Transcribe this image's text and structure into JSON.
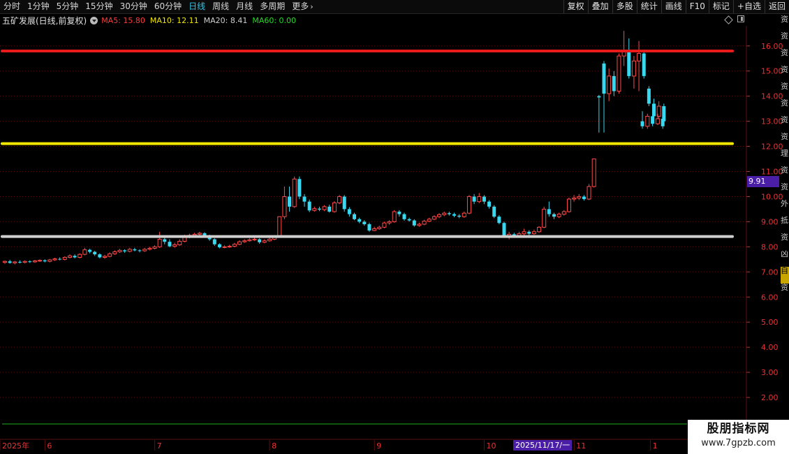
{
  "toolbar": {
    "periods": [
      "分时",
      "1分钟",
      "5分钟",
      "15分钟",
      "30分钟",
      "60分钟",
      "日线",
      "周线",
      "月线",
      "多周期",
      "更多"
    ],
    "active_period": "日线",
    "tools": [
      "复权",
      "叠加",
      "多股",
      "统计",
      "画线",
      "F10",
      "标记",
      "+自选",
      "返回"
    ]
  },
  "legend": {
    "title": "五矿发展(日线,前复权)",
    "ma": [
      {
        "label": "MA5: 15.80",
        "color": "#ff3b3b"
      },
      {
        "label": "MA10: 12.11",
        "color": "#f2e600"
      },
      {
        "label": "MA20: 8.41",
        "color": "#d0d0d0"
      },
      {
        "label": "MA60: 0.00",
        "color": "#22dd22"
      }
    ]
  },
  "price_tag": "9.91",
  "date_tag": "2025/11/17/一",
  "sidebar_items": [
    "资",
    "资",
    "资",
    "资",
    "资",
    "资",
    "资",
    "资",
    "理",
    "资",
    "资",
    "外",
    "抵",
    "资",
    "凶",
    "自",
    "资"
  ],
  "watermark": {
    "line1": "股朋指标网",
    "line2": "www.7gpzb.com"
  },
  "colors": {
    "up": "#ff4a4a",
    "down": "#37d8f0",
    "grid": "#5a1010",
    "background": "#000000"
  },
  "chart_data": {
    "type": "candlestick",
    "ylim": [
      1.0,
      16.8
    ],
    "y_ticks": [
      2.0,
      3.0,
      4.0,
      5.0,
      6.0,
      7.0,
      8.0,
      9.0,
      10.0,
      11.0,
      12.0,
      13.0,
      14.0,
      15.0,
      16.0
    ],
    "horizontal_lines": [
      {
        "value": 15.8,
        "color": "#e81a1a"
      },
      {
        "value": 12.11,
        "color": "#f2e600"
      },
      {
        "value": 8.41,
        "color": "#cfcfcf"
      }
    ],
    "x_labels": [
      {
        "text": "2025年",
        "index": 0
      },
      {
        "text": "6",
        "index": 9
      },
      {
        "text": "7",
        "index": 31
      },
      {
        "text": "8",
        "index": 54
      },
      {
        "text": "9",
        "index": 75
      },
      {
        "text": "10",
        "index": 97
      },
      {
        "text": "11",
        "index": 115
      },
      {
        "text": "1",
        "index": 155
      }
    ],
    "candles": [
      [
        7.38,
        7.42,
        7.32,
        7.45
      ],
      [
        7.42,
        7.36,
        7.33,
        7.48
      ],
      [
        7.36,
        7.4,
        7.3,
        7.44
      ],
      [
        7.4,
        7.38,
        7.34,
        7.46
      ],
      [
        7.38,
        7.42,
        7.34,
        7.46
      ],
      [
        7.42,
        7.4,
        7.36,
        7.46
      ],
      [
        7.4,
        7.44,
        7.36,
        7.48
      ],
      [
        7.44,
        7.46,
        7.4,
        7.5
      ],
      [
        7.46,
        7.42,
        7.38,
        7.5
      ],
      [
        7.42,
        7.48,
        7.38,
        7.52
      ],
      [
        7.48,
        7.52,
        7.44,
        7.56
      ],
      [
        7.52,
        7.5,
        7.46,
        7.58
      ],
      [
        7.5,
        7.58,
        7.46,
        7.62
      ],
      [
        7.58,
        7.64,
        7.54,
        7.7
      ],
      [
        7.64,
        7.58,
        7.54,
        7.7
      ],
      [
        7.58,
        7.7,
        7.54,
        7.74
      ],
      [
        7.7,
        7.88,
        7.66,
        7.96
      ],
      [
        7.88,
        7.8,
        7.74,
        7.92
      ],
      [
        7.8,
        7.7,
        7.64,
        7.84
      ],
      [
        7.7,
        7.58,
        7.54,
        7.74
      ],
      [
        7.58,
        7.62,
        7.52,
        7.68
      ],
      [
        7.62,
        7.72,
        7.58,
        7.78
      ],
      [
        7.72,
        7.8,
        7.68,
        7.86
      ],
      [
        7.8,
        7.86,
        7.76,
        7.92
      ],
      [
        7.86,
        7.82,
        7.76,
        7.9
      ],
      [
        7.82,
        7.9,
        7.78,
        7.96
      ],
      [
        7.9,
        7.86,
        7.82,
        7.96
      ],
      [
        7.86,
        7.84,
        7.78,
        7.9
      ],
      [
        7.84,
        7.9,
        7.8,
        7.96
      ],
      [
        7.9,
        7.94,
        7.86,
        8.0
      ],
      [
        7.94,
        8.0,
        7.9,
        8.06
      ],
      [
        8.0,
        8.3,
        7.96,
        8.6
      ],
      [
        8.3,
        8.2,
        8.1,
        8.4
      ],
      [
        8.2,
        8.02,
        7.98,
        8.3
      ],
      [
        8.02,
        8.08,
        7.96,
        8.16
      ],
      [
        8.08,
        8.22,
        8.04,
        8.3
      ],
      [
        8.22,
        8.4,
        8.18,
        8.48
      ],
      [
        8.4,
        8.46,
        8.34,
        8.52
      ],
      [
        8.46,
        8.5,
        8.4,
        8.56
      ],
      [
        8.5,
        8.54,
        8.44,
        8.6
      ],
      [
        8.54,
        8.42,
        8.36,
        8.58
      ],
      [
        8.42,
        8.3,
        8.24,
        8.48
      ],
      [
        8.3,
        8.1,
        8.04,
        8.34
      ],
      [
        8.1,
        7.98,
        7.94,
        8.14
      ],
      [
        7.98,
        8.0,
        7.94,
        8.06
      ],
      [
        8.0,
        8.02,
        7.96,
        8.08
      ],
      [
        8.02,
        8.1,
        7.98,
        8.16
      ],
      [
        8.1,
        8.2,
        8.06,
        8.26
      ],
      [
        8.2,
        8.24,
        8.16,
        8.3
      ],
      [
        8.24,
        8.28,
        8.2,
        8.34
      ],
      [
        8.28,
        8.3,
        8.24,
        8.36
      ],
      [
        8.3,
        8.18,
        8.12,
        8.34
      ],
      [
        8.18,
        8.24,
        8.14,
        8.3
      ],
      [
        8.24,
        8.3,
        8.2,
        8.38
      ],
      [
        8.3,
        8.4,
        8.26,
        8.46
      ],
      [
        8.4,
        9.2,
        8.38,
        9.2
      ],
      [
        9.2,
        10.0,
        9.1,
        10.4
      ],
      [
        10.0,
        9.6,
        9.4,
        10.4
      ],
      [
        9.6,
        10.7,
        9.55,
        10.8
      ],
      [
        10.7,
        10.0,
        9.9,
        10.8
      ],
      [
        10.0,
        9.8,
        9.6,
        10.1
      ],
      [
        9.8,
        9.45,
        9.38,
        9.88
      ],
      [
        9.45,
        9.52,
        9.4,
        9.6
      ],
      [
        9.52,
        9.48,
        9.42,
        9.6
      ],
      [
        9.48,
        9.6,
        9.42,
        9.66
      ],
      [
        9.6,
        9.4,
        9.36,
        9.68
      ],
      [
        9.4,
        9.75,
        9.36,
        9.82
      ],
      [
        9.75,
        10.0,
        9.7,
        10.06
      ],
      [
        10.0,
        9.5,
        9.4,
        10.06
      ],
      [
        9.5,
        9.3,
        9.2,
        9.58
      ],
      [
        9.3,
        9.1,
        9.06,
        9.36
      ],
      [
        9.1,
        9.0,
        8.94,
        9.16
      ],
      [
        9.0,
        8.9,
        8.84,
        9.06
      ],
      [
        8.9,
        8.65,
        8.6,
        8.96
      ],
      [
        8.65,
        8.72,
        8.62,
        8.8
      ],
      [
        8.72,
        8.78,
        8.68,
        8.84
      ],
      [
        8.78,
        8.95,
        8.74,
        9.0
      ],
      [
        8.95,
        9.0,
        8.88,
        9.06
      ],
      [
        9.0,
        9.4,
        8.96,
        9.46
      ],
      [
        9.4,
        9.3,
        9.2,
        9.46
      ],
      [
        9.3,
        9.1,
        9.04,
        9.36
      ],
      [
        9.1,
        9.05,
        9.0,
        9.16
      ],
      [
        9.05,
        8.85,
        8.8,
        9.1
      ],
      [
        8.85,
        8.9,
        8.8,
        8.96
      ],
      [
        8.9,
        9.02,
        8.86,
        9.08
      ],
      [
        9.02,
        9.1,
        8.98,
        9.16
      ],
      [
        9.1,
        9.2,
        9.06,
        9.26
      ],
      [
        9.2,
        9.28,
        9.14,
        9.34
      ],
      [
        9.28,
        9.34,
        9.22,
        9.4
      ],
      [
        9.34,
        9.3,
        9.24,
        9.4
      ],
      [
        9.3,
        9.24,
        9.18,
        9.36
      ],
      [
        9.24,
        9.2,
        9.14,
        9.3
      ],
      [
        9.2,
        9.34,
        9.16,
        9.4
      ],
      [
        9.34,
        10.0,
        9.3,
        10.06
      ],
      [
        10.0,
        9.8,
        9.7,
        10.1
      ],
      [
        9.8,
        10.0,
        9.74,
        10.14
      ],
      [
        10.0,
        9.8,
        9.7,
        10.06
      ],
      [
        9.8,
        9.6,
        9.52,
        9.86
      ],
      [
        9.6,
        9.2,
        9.14,
        9.66
      ],
      [
        9.2,
        8.95,
        8.9,
        9.26
      ],
      [
        8.95,
        8.4,
        8.36,
        9.0
      ],
      [
        8.4,
        8.5,
        8.3,
        8.6
      ],
      [
        8.5,
        8.45,
        8.38,
        8.56
      ],
      [
        8.45,
        8.52,
        8.4,
        8.6
      ],
      [
        8.52,
        8.6,
        8.46,
        8.72
      ],
      [
        8.6,
        8.52,
        8.46,
        8.66
      ],
      [
        8.52,
        8.6,
        8.48,
        8.68
      ],
      [
        8.6,
        8.78,
        8.56,
        8.82
      ],
      [
        8.78,
        9.5,
        8.74,
        9.6
      ],
      [
        9.5,
        9.3,
        9.2,
        9.8
      ],
      [
        9.3,
        9.2,
        9.1,
        9.36
      ],
      [
        9.2,
        9.3,
        9.14,
        9.36
      ],
      [
        9.3,
        9.4,
        9.24,
        9.46
      ],
      [
        9.4,
        9.9,
        9.36,
        9.96
      ],
      [
        9.9,
        9.94,
        9.8,
        10.06
      ],
      [
        9.94,
        10.0,
        9.86,
        10.1
      ],
      [
        10.0,
        9.9,
        9.84,
        10.06
      ],
      [
        9.9,
        10.4,
        9.86,
        10.5
      ],
      [
        10.4,
        11.5,
        10.36,
        11.5
      ],
      [
        14.0,
        13.95,
        12.55,
        14.05
      ],
      [
        15.3,
        14.1,
        12.55,
        15.4
      ],
      [
        14.1,
        14.8,
        13.8,
        15.1
      ],
      [
        14.8,
        14.2,
        14.0,
        15.0
      ],
      [
        14.2,
        15.6,
        14.1,
        15.7
      ],
      [
        15.6,
        15.8,
        15.2,
        16.6
      ],
      [
        15.8,
        14.8,
        14.7,
        16.3
      ],
      [
        14.8,
        15.4,
        14.3,
        15.6
      ],
      [
        15.4,
        15.7,
        14.2,
        16.2
      ],
      [
        15.7,
        14.8,
        14.7,
        15.8
      ],
      [
        14.3,
        13.7,
        13.6,
        14.4
      ],
      [
        13.7,
        13.2,
        13.1,
        13.9
      ],
      [
        13.2,
        13.6,
        13.1,
        13.8
      ],
      [
        13.6,
        13.0,
        12.9,
        13.7
      ],
      [
        13.0,
        12.8,
        12.7,
        13.4
      ],
      [
        12.8,
        13.2,
        12.7,
        13.3
      ],
      [
        13.2,
        12.9,
        12.8,
        13.3
      ],
      [
        12.9,
        13.1,
        12.85,
        13.3
      ],
      [
        13.1,
        12.8,
        12.7,
        13.2
      ]
    ],
    "candle_x_positions_note": "candle spacing derived in script"
  }
}
